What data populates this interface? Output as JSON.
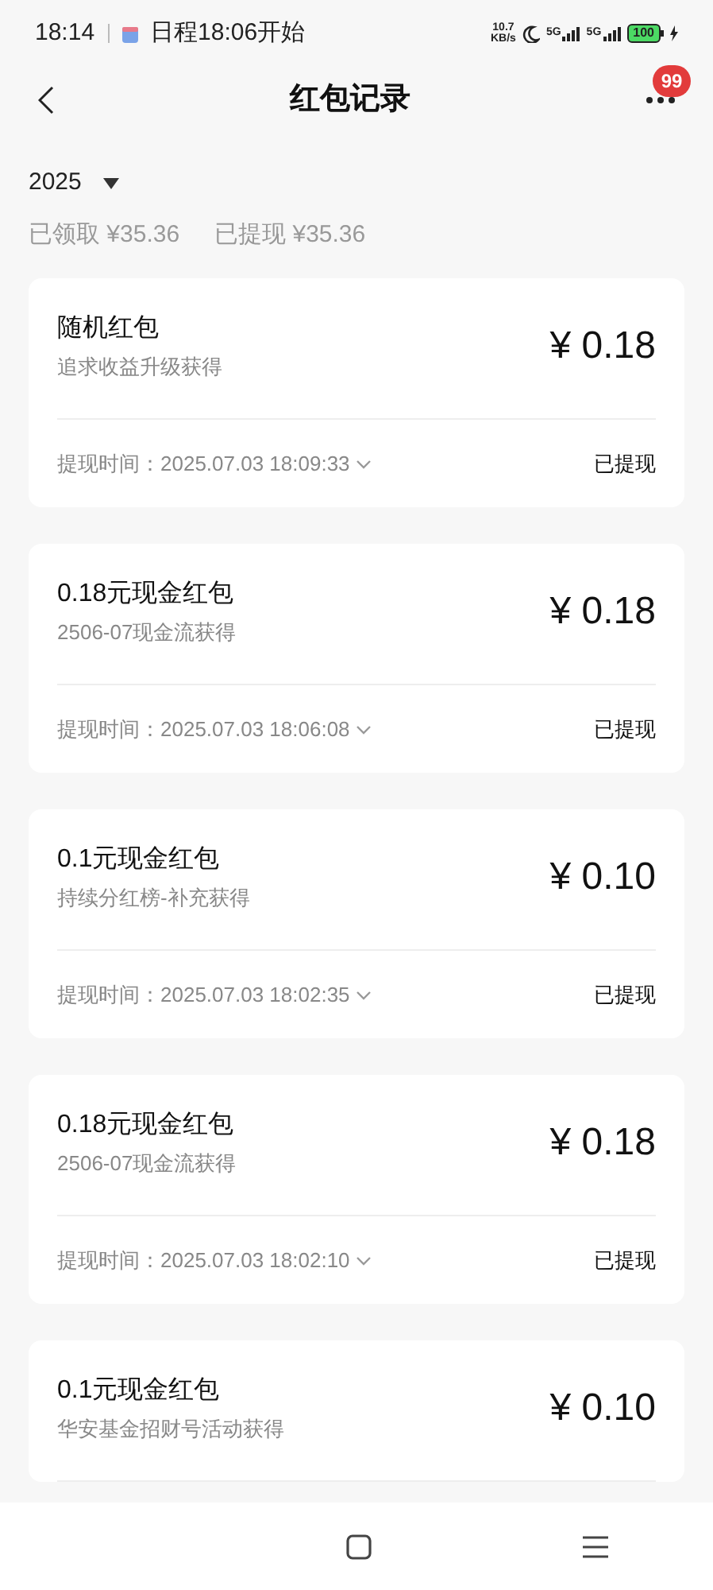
{
  "status_bar": {
    "time": "18:14",
    "notification": "日程18:06开始",
    "net_speed_value": "10.7",
    "net_speed_unit": "KB/s",
    "signal_1": "5G",
    "signal_2": "5G",
    "battery": "100"
  },
  "header": {
    "title": "红包记录",
    "badge": "99"
  },
  "filter": {
    "year": "2025"
  },
  "summary": [
    {
      "label": "已领取",
      "amount": "¥35.36"
    },
    {
      "label": "已提现",
      "amount": "¥35.36"
    }
  ],
  "records": [
    {
      "title": "随机红包",
      "source": "追求收益升级获得",
      "amount": "¥ 0.18",
      "time_label": "提现时间：",
      "time": "2025.07.03 18:09:33",
      "status": "已提现"
    },
    {
      "title": "0.18元现金红包",
      "source": "2506-07现金流获得",
      "amount": "¥ 0.18",
      "time_label": "提现时间：",
      "time": "2025.07.03 18:06:08",
      "status": "已提现"
    },
    {
      "title": "0.1元现金红包",
      "source": "持续分红榜-补充获得",
      "amount": "¥ 0.10",
      "time_label": "提现时间：",
      "time": "2025.07.03 18:02:35",
      "status": "已提现"
    },
    {
      "title": "0.18元现金红包",
      "source": "2506-07现金流获得",
      "amount": "¥ 0.18",
      "time_label": "提现时间：",
      "time": "2025.07.03 18:02:10",
      "status": "已提现"
    },
    {
      "title": "0.1元现金红包",
      "source": "华安基金招财号活动获得",
      "amount": "¥ 0.10"
    }
  ]
}
